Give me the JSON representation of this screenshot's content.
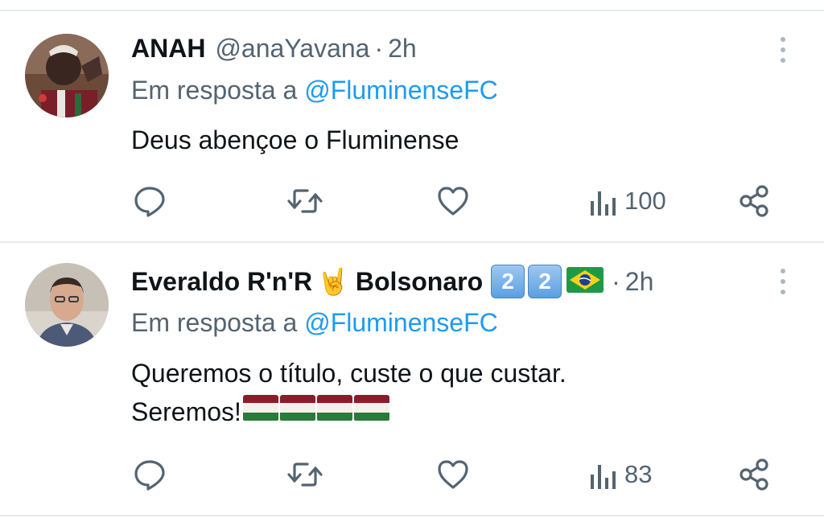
{
  "tweets": [
    {
      "name": "ANAH",
      "handle": "@anaYavana",
      "separator": "·",
      "time": "2h",
      "reply_prefix": "Em resposta a ",
      "reply_to": "@FluminenseFC",
      "text_lines": [
        "Deus abençoe o Fluminense"
      ],
      "views": "100",
      "avatar_icon": "avatar-photo"
    },
    {
      "name_part1": "Everaldo R'n'R",
      "name_emoji": "🤘",
      "name_part2": "Bolsonaro",
      "name_badges": [
        "2",
        "2"
      ],
      "handle": "",
      "separator": "·",
      "time": "2h",
      "reply_prefix": "Em resposta a ",
      "reply_to": "@FluminenseFC",
      "text_lines": [
        "Queremos o título, custe o que custar.",
        "Seremos!"
      ],
      "views": "83",
      "avatar_icon": "avatar-photo"
    }
  ],
  "colors": {
    "text": "#0f1419",
    "secondary": "#536471",
    "link": "#1d9bf0",
    "divider": "#e6e9ec"
  },
  "icons": [
    "reply-icon",
    "retweet-icon",
    "like-icon",
    "views-icon",
    "share-icon",
    "more-icon"
  ]
}
